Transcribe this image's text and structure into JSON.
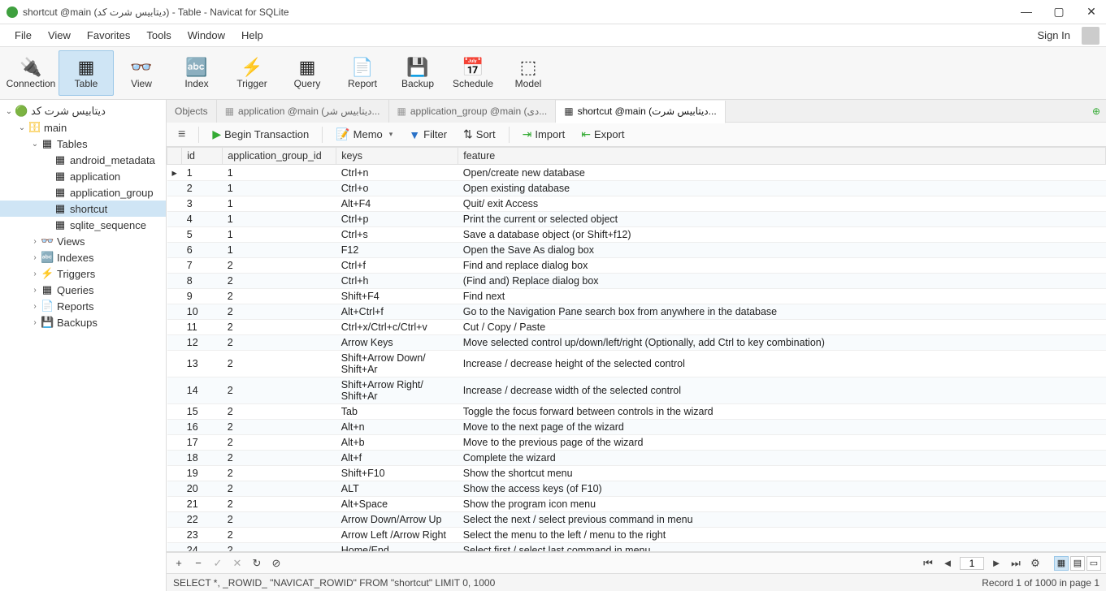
{
  "window": {
    "title": "shortcut @main (دیتابیس شرت کد) - Table - Navicat for SQLite"
  },
  "menu": [
    "File",
    "View",
    "Favorites",
    "Tools",
    "Window",
    "Help"
  ],
  "signin": "Sign In",
  "toolbar": [
    {
      "name": "connection",
      "label": "Connection",
      "glyph": "🔌"
    },
    {
      "name": "table",
      "label": "Table",
      "glyph": "▦",
      "active": true
    },
    {
      "name": "view",
      "label": "View",
      "glyph": "👓"
    },
    {
      "name": "index",
      "label": "Index",
      "glyph": "🔤"
    },
    {
      "name": "trigger",
      "label": "Trigger",
      "glyph": "⚡"
    },
    {
      "name": "query",
      "label": "Query",
      "glyph": "▦"
    },
    {
      "name": "report",
      "label": "Report",
      "glyph": "📄"
    },
    {
      "name": "backup",
      "label": "Backup",
      "glyph": "💾"
    },
    {
      "name": "schedule",
      "label": "Schedule",
      "glyph": "📅"
    },
    {
      "name": "model",
      "label": "Model",
      "glyph": "⬚"
    }
  ],
  "tree": [
    {
      "level": 1,
      "exp": "⌄",
      "icon": "🟢",
      "label": "دیتابیس شرت کد",
      "color": "#2a7"
    },
    {
      "level": 2,
      "exp": "⌄",
      "icon": "🗄",
      "label": "main",
      "color": "#f7b500"
    },
    {
      "level": 3,
      "exp": "⌄",
      "icon": "▦",
      "label": "Tables"
    },
    {
      "level": 4,
      "exp": "",
      "icon": "▦",
      "label": "android_metadata"
    },
    {
      "level": 4,
      "exp": "",
      "icon": "▦",
      "label": "application"
    },
    {
      "level": 4,
      "exp": "",
      "icon": "▦",
      "label": "application_group"
    },
    {
      "level": 4,
      "exp": "",
      "icon": "▦",
      "label": "shortcut",
      "selected": true
    },
    {
      "level": 4,
      "exp": "",
      "icon": "▦",
      "label": "sqlite_sequence"
    },
    {
      "level": 3,
      "exp": "›",
      "icon": "👓",
      "label": "Views"
    },
    {
      "level": 3,
      "exp": "›",
      "icon": "🔤",
      "label": "Indexes"
    },
    {
      "level": 3,
      "exp": "›",
      "icon": "⚡",
      "label": "Triggers"
    },
    {
      "level": 3,
      "exp": "›",
      "icon": "▦",
      "label": "Queries"
    },
    {
      "level": 3,
      "exp": "›",
      "icon": "📄",
      "label": "Reports"
    },
    {
      "level": 3,
      "exp": "›",
      "icon": "💾",
      "label": "Backups"
    }
  ],
  "tabs": [
    {
      "label": "Objects",
      "active": false
    },
    {
      "label": "application @main (دیتابیس شر...",
      "active": false,
      "icon": "▦"
    },
    {
      "label": "application_group @main (دی...",
      "active": false,
      "icon": "▦"
    },
    {
      "label": "shortcut @main (دیتابیس شرت...",
      "active": true,
      "icon": "▦"
    }
  ],
  "actions": {
    "begin_transaction": "Begin Transaction",
    "memo": "Memo",
    "filter": "Filter",
    "sort": "Sort",
    "import": "Import",
    "export": "Export"
  },
  "columns": [
    "id",
    "application_group_id",
    "keys",
    "feature"
  ],
  "rows": [
    {
      "id": "1",
      "gid": "1",
      "keys": "Ctrl+n",
      "feature": "Open/create new database",
      "current": true
    },
    {
      "id": "2",
      "gid": "1",
      "keys": "Ctrl+o",
      "feature": "Open existing database"
    },
    {
      "id": "3",
      "gid": "1",
      "keys": "Alt+F4",
      "feature": "Quit/ exit Access"
    },
    {
      "id": "4",
      "gid": "1",
      "keys": "Ctrl+p",
      "feature": "Print the current or selected object"
    },
    {
      "id": "5",
      "gid": "1",
      "keys": "Ctrl+s",
      "feature": "Save a database object (or Shift+f12)"
    },
    {
      "id": "6",
      "gid": "1",
      "keys": "F12",
      "feature": "Open the Save As dialog box"
    },
    {
      "id": "7",
      "gid": "2",
      "keys": "Ctrl+f",
      "feature": "Find and replace dialog box"
    },
    {
      "id": "8",
      "gid": "2",
      "keys": "Ctrl+h",
      "feature": "(Find and) Replace dialog box"
    },
    {
      "id": "9",
      "gid": "2",
      "keys": "Shift+F4",
      "feature": "Find next"
    },
    {
      "id": "10",
      "gid": "2",
      "keys": "Alt+Ctrl+f",
      "feature": "Go to the Navigation Pane search box from anywhere in the database"
    },
    {
      "id": "11",
      "gid": "2",
      "keys": "Ctrl+x/Ctrl+c/Ctrl+v",
      "feature": "Cut / Copy / Paste"
    },
    {
      "id": "12",
      "gid": "2",
      "keys": "Arrow Keys",
      "feature": "Move selected control up/down/left/right (Optionally, add Ctrl to key combination)"
    },
    {
      "id": "13",
      "gid": "2",
      "keys": "Shift+Arrow Down/ Shift+Ar",
      "feature": "Increase / decrease height of the selected control"
    },
    {
      "id": "14",
      "gid": "2",
      "keys": "Shift+Arrow Right/ Shift+Ar",
      "feature": "Increase / decrease width of the selected control"
    },
    {
      "id": "15",
      "gid": "2",
      "keys": "Tab",
      "feature": "Toggle the focus forward between controls in the wizard"
    },
    {
      "id": "16",
      "gid": "2",
      "keys": "Alt+n",
      "feature": "Move to the next page of the wizard"
    },
    {
      "id": "17",
      "gid": "2",
      "keys": "Alt+b",
      "feature": "Move to the previous page of the wizard"
    },
    {
      "id": "18",
      "gid": "2",
      "keys": "Alt+f",
      "feature": "Complete the wizard"
    },
    {
      "id": "19",
      "gid": "2",
      "keys": "Shift+F10",
      "feature": "Show the shortcut menu"
    },
    {
      "id": "20",
      "gid": "2",
      "keys": "ALT",
      "feature": "Show the access keys (of F10)"
    },
    {
      "id": "21",
      "gid": "2",
      "keys": "Alt+Space",
      "feature": "Show the program icon menu"
    },
    {
      "id": "22",
      "gid": "2",
      "keys": "Arrow Down/Arrow Up",
      "feature": "Select the next / select previous command in menu"
    },
    {
      "id": "23",
      "gid": "2",
      "keys": "Arrow Left /Arrow Right",
      "feature": "Select the menu to the left / menu to the right"
    },
    {
      "id": "24",
      "gid": "2",
      "keys": "Home/End",
      "feature": "Select first / select last command in menu"
    }
  ],
  "nav": {
    "page": "1"
  },
  "status": {
    "query": "SELECT *, _ROWID_ \"NAVICAT_ROWID\" FROM \"shortcut\" LIMIT 0, 1000",
    "record": "Record 1 of 1000 in page 1"
  }
}
